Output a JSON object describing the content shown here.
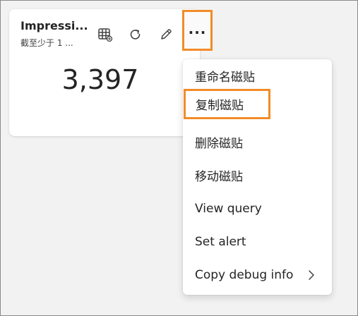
{
  "tile": {
    "title": "Impressi...",
    "subtitle": "截至少于 1 ...",
    "value": "3,397"
  },
  "toolbar": {
    "icons": [
      "table-icon",
      "refresh-icon",
      "edit-icon",
      "more-icon"
    ],
    "more_label": "..."
  },
  "menu": {
    "items": [
      {
        "label": "重命名磁贴"
      },
      {
        "label": "复制磁贴"
      },
      {
        "label": "删除磁贴"
      },
      {
        "label": "移动磁贴"
      },
      {
        "label": "View query"
      },
      {
        "label": "Set alert"
      },
      {
        "label": "Copy debug info"
      }
    ]
  },
  "colors": {
    "highlight": "#f28c28",
    "background": "#f2f2f2",
    "text": "#242424"
  }
}
